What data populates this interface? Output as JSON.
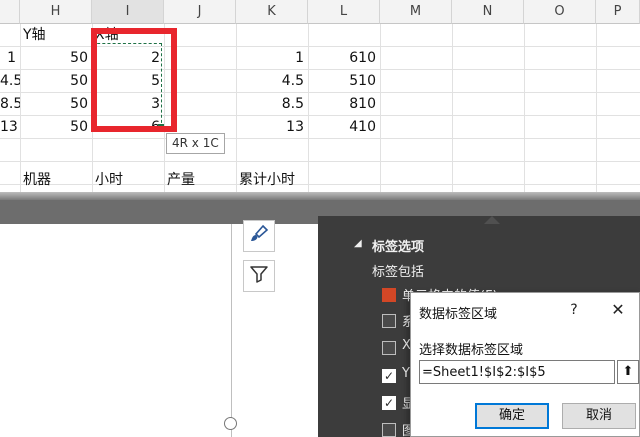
{
  "sheet": {
    "columns": [
      "H",
      "I",
      "J",
      "K",
      "L",
      "M",
      "N",
      "O",
      "P"
    ],
    "header_row": {
      "h": "Y轴",
      "i": "X轴"
    },
    "rows": [
      {
        "g": "1",
        "h": "50",
        "i": "2",
        "k": "1",
        "l": "610"
      },
      {
        "g": "4.5",
        "h": "50",
        "i": "5",
        "k": "4.5",
        "l": "510"
      },
      {
        "g": "8.5",
        "h": "50",
        "i": "3",
        "k": "8.5",
        "l": "810"
      },
      {
        "g": "13",
        "h": "50",
        "i": "6",
        "k": "13",
        "l": "410"
      }
    ],
    "selection_size": "4R x 1C",
    "table_header": [
      "机器",
      "小时",
      "产量",
      "累计小时"
    ]
  },
  "format_pane": {
    "section_title": "标签选项",
    "subsection": "标签包括",
    "options": [
      {
        "label": "单元格中的值(F)",
        "state": "orange"
      },
      {
        "label": "系",
        "state": "unchecked"
      },
      {
        "label": "X",
        "state": "unchecked"
      },
      {
        "label": "Y",
        "state": "checked"
      },
      {
        "label": "显",
        "state": "checked"
      },
      {
        "label": "图",
        "state": "unchecked"
      }
    ]
  },
  "dialog": {
    "title": "数据标签区域",
    "help": "?",
    "close": "✕",
    "prompt": "选择数据标签区域",
    "range_value": "=Sheet1!$I$2:$I$5",
    "collapse_icon": "⬆",
    "ok_label": "确定",
    "cancel_label": "取消"
  },
  "colors": {
    "selection_red": "#e8262d",
    "marquee_green": "#1e7145",
    "pane_bg": "#3c3c3c",
    "accent_blue": "#0078d7"
  }
}
